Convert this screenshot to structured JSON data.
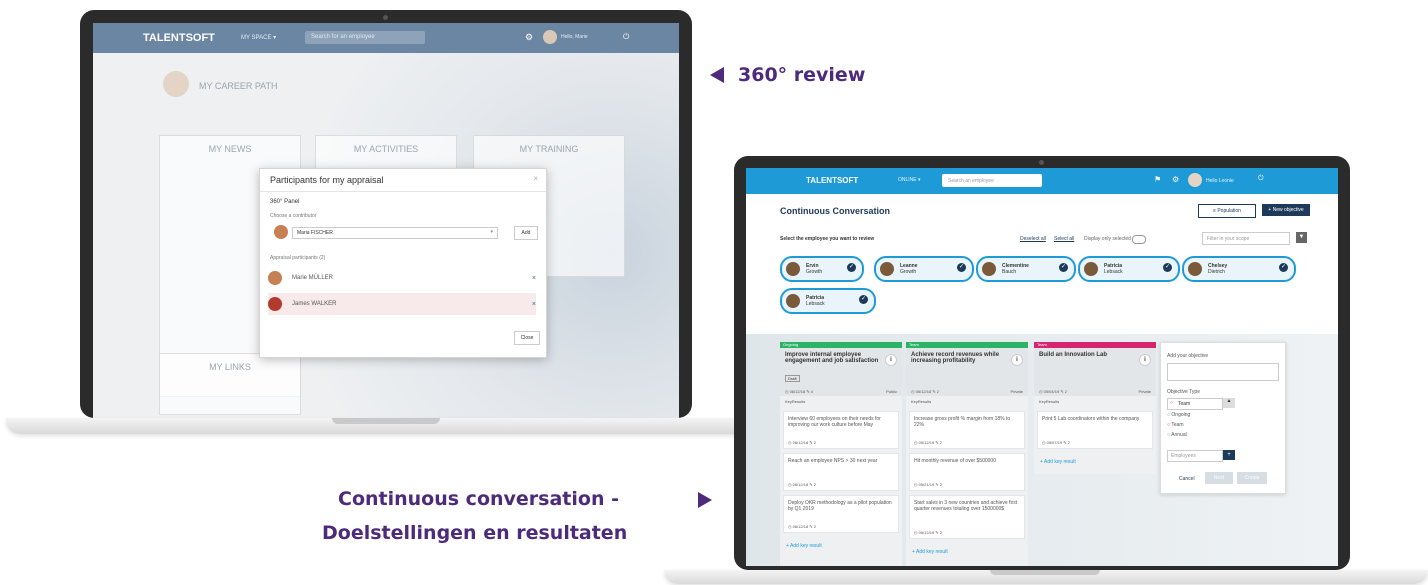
{
  "callouts": {
    "review360": "360° review",
    "continuous_line1": "Continuous conversation -",
    "continuous_line2": "Doelstellingen en resultaten"
  },
  "left_app": {
    "brand": "TALENTSOFT",
    "menu": "MY SPACE ▾",
    "search_placeholder": "Search for an employee",
    "user": "Hello, Marie",
    "profile_name": "MY CAREER PATH",
    "cards": [
      "MY NEWS",
      "MY ACTIVITIES",
      "MY TRAINING",
      "MY LINKS"
    ],
    "modal": {
      "title": "Participants for my appraisal",
      "panel": "360° Panel",
      "choose_label": "Choose a contributor",
      "selected": "Maria FISCHER",
      "add": "Add",
      "list_label": "Appraisal participants (2)",
      "participants": [
        "Marie MÜLLER",
        "James WALKER"
      ],
      "close": "Close"
    }
  },
  "right_app": {
    "brand": "TALENTSOFT",
    "menu": "ONLINE ▾",
    "search_placeholder": "Search an employee",
    "user": "Hello Leonie",
    "page_title": "Continuous Conversation",
    "filter_btn": "Population",
    "new_btn": "+ New objective",
    "select_label": "Select the employee you want to review",
    "deselect": "Deselect all",
    "select_all": "Select all",
    "display_only": "Display only selected",
    "filter_placeholder": "Filter in your scope",
    "employees": [
      {
        "name": "Ervin",
        "role": "Growth"
      },
      {
        "name": "Leanne",
        "role": "Growth"
      },
      {
        "name": "Clementine",
        "role": "Bauch"
      },
      {
        "name": "Patricia",
        "role": "Lebsack"
      },
      {
        "name": "Chelsey",
        "role": "Dietrich"
      },
      {
        "name": "Patricia",
        "role": "Lebsack"
      }
    ],
    "columns": [
      {
        "tag": "Ongoing",
        "color": "#2db366",
        "objective": "Improve internal employee engagement and job satisfaction",
        "status": "Draft",
        "date": "06/12/18",
        "count": "4",
        "visibility": "Public",
        "krs_label": "KeyResults",
        "krs": [
          {
            "text": "Interview 60 employees on their needs for improving our work culture before May",
            "date": "06/12/18",
            "count": "2"
          },
          {
            "text": "Reach an employee NPS > 30 next year",
            "date": "06/12/18",
            "count": "2"
          },
          {
            "text": "Deploy OKR methodology as a pilot population by Q1 2019",
            "date": "06/12/18",
            "count": "2"
          }
        ],
        "add": "+ Add key result"
      },
      {
        "tag": "Team",
        "color": "#2db366",
        "objective": "Achieve record revenues while increasing profitability",
        "status": "",
        "date": "06/12/18",
        "count": "2",
        "visibility": "Private",
        "krs_label": "KeyResults",
        "krs": [
          {
            "text": "Increase gross profit % margin from 18% to 22%",
            "date": "05/12/19",
            "count": "2"
          },
          {
            "text": "Hit monthly revenue of over $500000",
            "date": "05/21/19",
            "count": "2"
          },
          {
            "text": "Start sales in 3 new countries and achieve first quarter revenues totaling over 1500000$",
            "date": "05/12/19",
            "count": "2"
          }
        ],
        "add": "+ Add key result"
      },
      {
        "tag": "Team",
        "color": "#d6246e",
        "objective": "Build an Innovation Lab",
        "status": "",
        "date": "05/04/19",
        "count": "2",
        "visibility": "Private",
        "krs_label": "KeyResults",
        "krs": [
          {
            "text": "Print 5 Lab coordinators within the company",
            "date": "05/07/19",
            "count": "2"
          }
        ],
        "add": "+ Add key result"
      }
    ],
    "new_objective": {
      "label": "Add your objective",
      "type_label": "Objective Type",
      "selected": "Team",
      "options": [
        "Ongoing",
        "Team",
        "Annual"
      ],
      "employee_placeholder": "Employees",
      "cancel": "Cancel",
      "next": "Next",
      "create": "Create"
    }
  }
}
